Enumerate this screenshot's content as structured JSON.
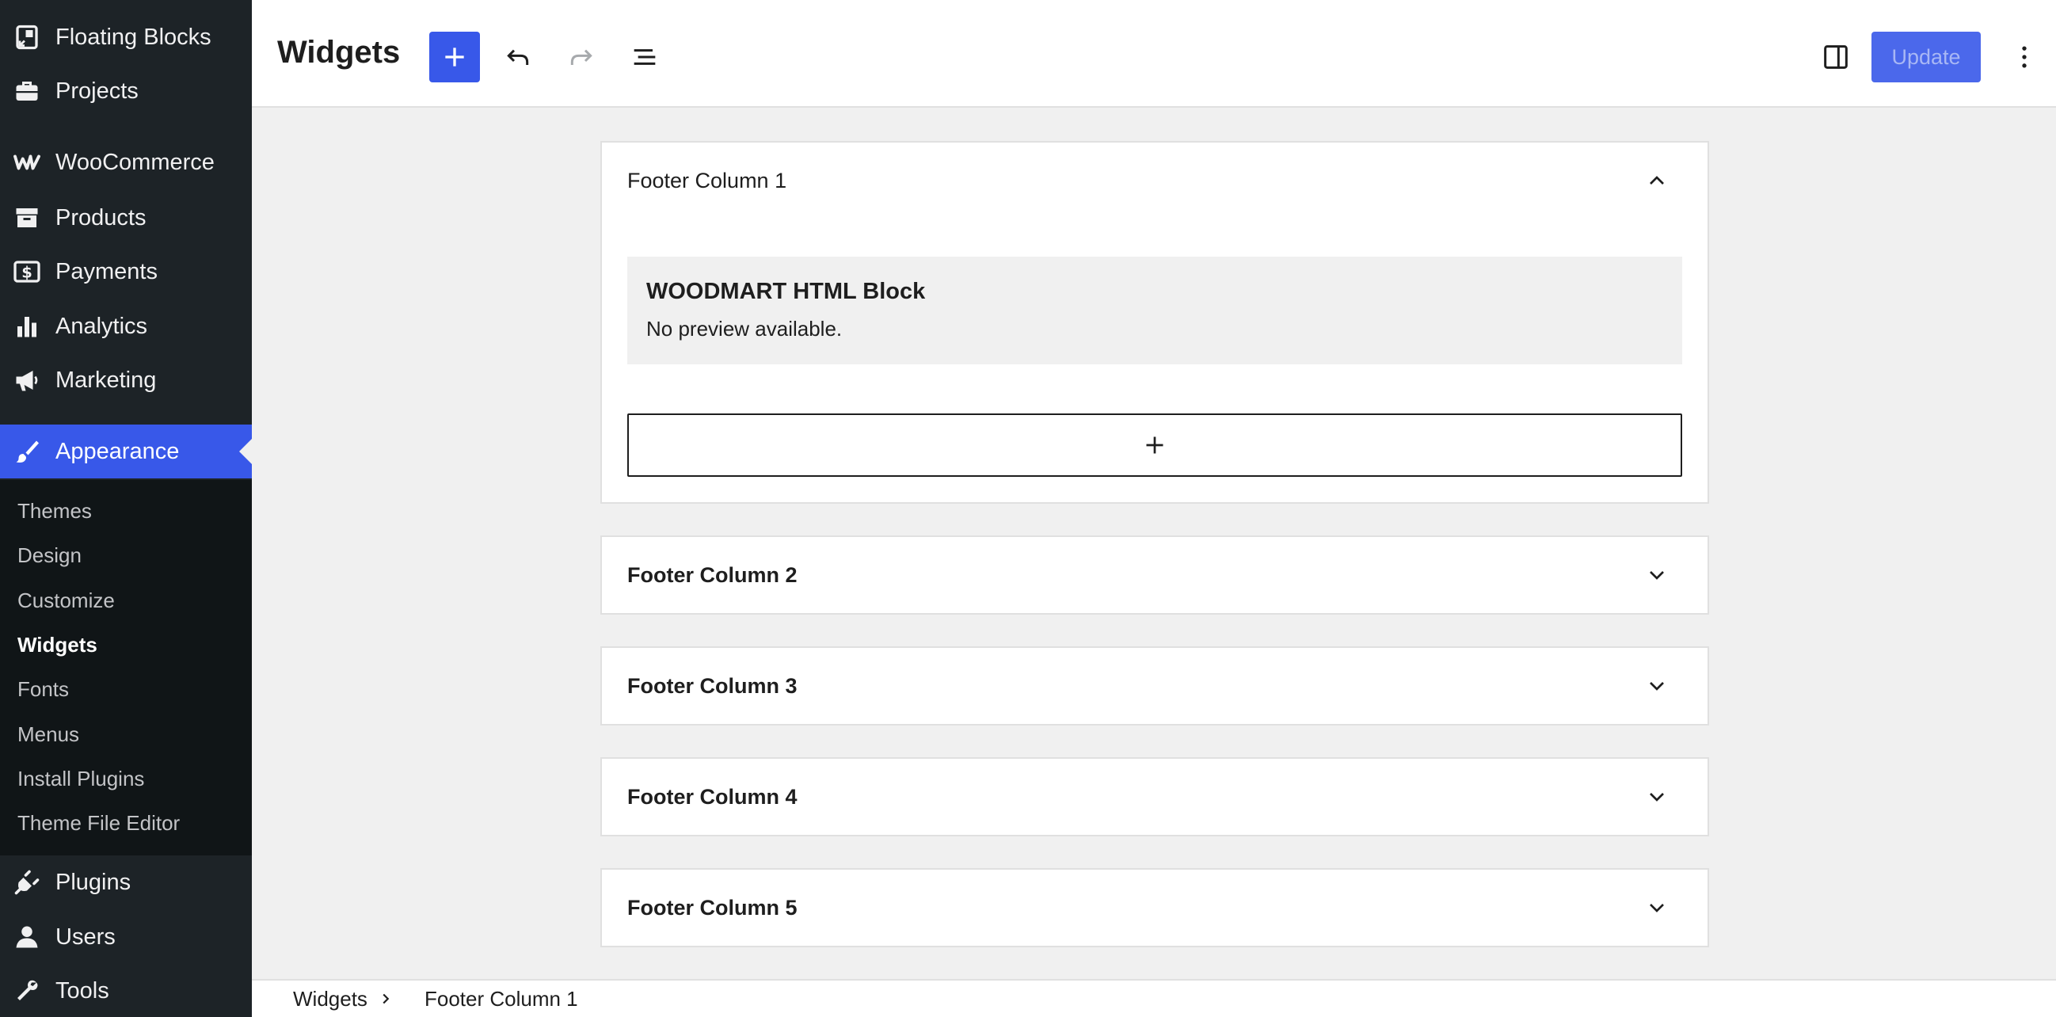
{
  "sidebar": {
    "items": [
      {
        "label": "Floating Blocks",
        "icon": "floating-blocks-icon"
      },
      {
        "label": "Projects",
        "icon": "briefcase-icon"
      },
      {
        "label": "WooCommerce",
        "icon": "woocommerce-icon"
      },
      {
        "label": "Products",
        "icon": "archive-icon"
      },
      {
        "label": "Payments",
        "icon": "dollar-icon"
      },
      {
        "label": "Analytics",
        "icon": "bar-chart-icon"
      },
      {
        "label": "Marketing",
        "icon": "megaphone-icon"
      },
      {
        "label": "Appearance",
        "icon": "paintbrush-icon",
        "current": true
      },
      {
        "label": "Plugins",
        "icon": "plug-icon"
      },
      {
        "label": "Users",
        "icon": "user-icon"
      },
      {
        "label": "Tools",
        "icon": "wrench-icon"
      }
    ],
    "submenu": [
      {
        "label": "Themes"
      },
      {
        "label": "Design"
      },
      {
        "label": "Customize"
      },
      {
        "label": "Widgets",
        "active": true
      },
      {
        "label": "Fonts"
      },
      {
        "label": "Menus"
      },
      {
        "label": "Install Plugins"
      },
      {
        "label": "Theme File Editor"
      }
    ]
  },
  "header": {
    "title": "Widgets",
    "update_label": "Update",
    "accent_color": "#3858e9"
  },
  "widget_areas": [
    {
      "title": "Footer Column 1",
      "expanded": true,
      "blocks": [
        {
          "title": "WOODMART HTML Block",
          "preview": "No preview available."
        }
      ]
    },
    {
      "title": "Footer Column 2",
      "expanded": false
    },
    {
      "title": "Footer Column 3",
      "expanded": false
    },
    {
      "title": "Footer Column 4",
      "expanded": false
    },
    {
      "title": "Footer Column 5",
      "expanded": false
    }
  ],
  "breadcrumb": {
    "root": "Widgets",
    "current": "Footer Column 1"
  }
}
